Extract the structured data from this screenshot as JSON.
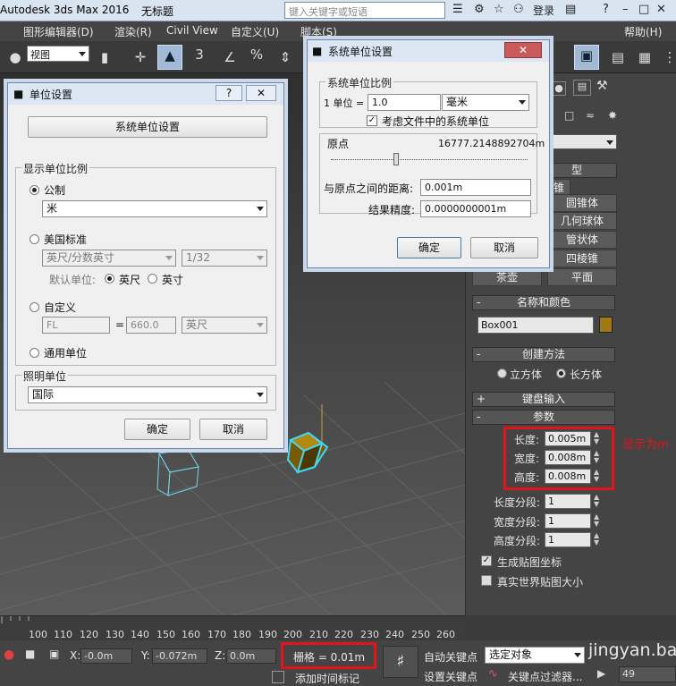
{
  "titlebar": {
    "app": "Autodesk 3ds Max 2016",
    "doc": "无标题",
    "search_placeholder": "键入关键字或短语",
    "login": "登录",
    "help": "?"
  },
  "menubar": [
    "图形编辑器(D)",
    "渲染(R)",
    "Civil View",
    "自定义(U)",
    "脚本(S)",
    "帮助(H)"
  ],
  "toolbar": {
    "view_select": "视图",
    "snap_3": "3",
    "percent": "%"
  },
  "units_dialog": {
    "title": "单位设置",
    "system_button": "系统单位设置",
    "display_group": "显示单位比例",
    "metric": "公制",
    "metric_value": "米",
    "us": "美国标准",
    "us_value": "英尺/分数英寸",
    "fraction": "1/32",
    "default_unit_label": "默认单位:",
    "feet": "英尺",
    "inches": "英寸",
    "custom": "自定义",
    "custom_name": "FL",
    "equals": "=",
    "custom_value": "660.0",
    "custom_unit": "英尺",
    "generic": "通用单位",
    "lighting_group": "照明单位",
    "lighting_value": "国际",
    "ok": "确定",
    "cancel": "取消"
  },
  "system_dialog": {
    "title": "系统单位设置",
    "scale_group": "系统单位比例",
    "unit_prefix": "1 单位 =",
    "unit_value": "1.0",
    "unit_select": "毫米",
    "respect_label": "考虑文件中的系统单位",
    "origin_label": "原点",
    "origin_value": "16777.2148892704m",
    "distance_label": "与原点之间的距离:",
    "distance_value": "0.001m",
    "precision_label": "结果精度:",
    "precision_value": "0.0000000001m",
    "ok": "确定",
    "cancel": "取消"
  },
  "panel": {
    "object_types": [
      "锥",
      "圆锥体",
      "几何球体",
      "管状体",
      "四棱锥",
      "平面"
    ],
    "object_type_header": "型",
    "teapot": "茶壶",
    "name_color": "名称和颜色",
    "name_value": "Box001",
    "creation_method": "创建方法",
    "cube": "立方体",
    "box": "长方体",
    "keyboard_input": "键盘输入",
    "params": "参数",
    "length_label": "长度:",
    "length_value": "0.005m",
    "width_label": "宽度:",
    "width_value": "0.008m",
    "height_label": "高度:",
    "height_value": "0.008m",
    "length_segs_label": "长度分段:",
    "length_segs": "1",
    "width_segs_label": "宽度分段:",
    "width_segs": "1",
    "height_segs_label": "高度分段:",
    "height_segs": "1",
    "gen_mapping": "生成贴图坐标",
    "real_world": "真实世界贴图大小",
    "annotation": "显示为m"
  },
  "timeline": {
    "ticks": [
      "100",
      "110",
      "120",
      "130",
      "140",
      "150",
      "160",
      "170",
      "180",
      "190",
      "200",
      "210",
      "220",
      "230",
      "240",
      "250",
      "260",
      "270",
      "280",
      "290"
    ]
  },
  "status": {
    "x_label": "X:",
    "x_value": "-0.0m",
    "y_label": "Y:",
    "y_value": "-0.072m",
    "z_label": "Z:",
    "z_value": "0.0m",
    "grid": "栅格 = 0.01m",
    "add_time_tag": "添加时间标记",
    "auto_key": "自动关键点",
    "set_key": "设置关键点",
    "selected": "选定对象",
    "key_filter": "关键点过滤器...",
    "frame": "49",
    "watermark": "jingyan.ba"
  }
}
